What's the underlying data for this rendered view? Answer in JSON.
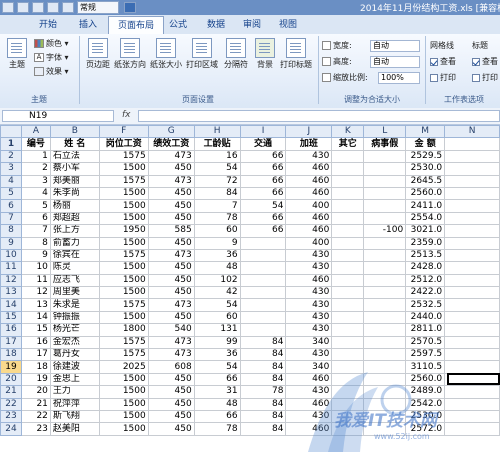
{
  "window": {
    "title": "2014年11月份结构工资.xls [兼容模式]",
    "qa_combo": "常规"
  },
  "tabs": [
    "开始",
    "插入",
    "页面布局",
    "公式",
    "数据",
    "审阅",
    "视图"
  ],
  "active_tab": "页面布局",
  "ribbon": {
    "theme_group": {
      "label": "主题",
      "theme_button": "主题",
      "colors": "颜色",
      "fonts": "字体",
      "effects": "效果"
    },
    "page_setup_group": {
      "label": "页面设置",
      "buttons": [
        "页边距",
        "纸张方向",
        "纸张大小",
        "打印区域",
        "分隔符",
        "背景",
        "打印标题"
      ]
    },
    "scale_group": {
      "label": "调整为合适大小",
      "width_label": "宽度:",
      "width_value": "自动",
      "height_label": "高度:",
      "height_value": "自动",
      "scale_label": "缩放比例:",
      "scale_value": "100%"
    },
    "sheet_options_group": {
      "label": "工作表选项",
      "gridlines": "网格线",
      "headings": "标题",
      "view": "查看",
      "print": "打印"
    }
  },
  "formula_bar": {
    "name_box": "N19",
    "fx": "fx"
  },
  "columns": [
    "A",
    "B",
    "F",
    "G",
    "H",
    "I",
    "J",
    "K",
    "L",
    "M",
    "N"
  ],
  "header_row": {
    "row": "1",
    "cells": [
      "编号",
      "姓 名",
      "岗位工资",
      "绩效工资",
      "工龄贴",
      "交通",
      "加班",
      "其它",
      "病事假",
      "金  额",
      ""
    ]
  },
  "rows": [
    {
      "row": "2",
      "cells": [
        "1",
        "石立法",
        "1575",
        "473",
        "16",
        "66",
        "430",
        "",
        "",
        "2529.5",
        ""
      ]
    },
    {
      "row": "3",
      "cells": [
        "2",
        "蔡小军",
        "1500",
        "450",
        "54",
        "66",
        "460",
        "",
        "",
        "2530.0",
        ""
      ]
    },
    {
      "row": "4",
      "cells": [
        "3",
        "郑美丽",
        "1575",
        "473",
        "72",
        "66",
        "460",
        "",
        "",
        "2645.5",
        ""
      ]
    },
    {
      "row": "5",
      "cells": [
        "4",
        "朱李尚",
        "1500",
        "450",
        "84",
        "66",
        "460",
        "",
        "",
        "2560.0",
        ""
      ]
    },
    {
      "row": "6",
      "cells": [
        "5",
        "杨丽",
        "1500",
        "450",
        "7",
        "54",
        "400",
        "",
        "",
        "2411.0",
        ""
      ]
    },
    {
      "row": "7",
      "cells": [
        "6",
        "郑超超",
        "1500",
        "450",
        "78",
        "66",
        "460",
        "",
        "",
        "2554.0",
        ""
      ]
    },
    {
      "row": "8",
      "cells": [
        "7",
        "张上方",
        "1950",
        "585",
        "60",
        "66",
        "460",
        "",
        "-100",
        "3021.0",
        ""
      ]
    },
    {
      "row": "9",
      "cells": [
        "8",
        "俞蓄力",
        "1500",
        "450",
        "9",
        "",
        "400",
        "",
        "",
        "2359.0",
        ""
      ]
    },
    {
      "row": "10",
      "cells": [
        "9",
        "徐宾在",
        "1575",
        "473",
        "36",
        "",
        "430",
        "",
        "",
        "2513.5",
        ""
      ]
    },
    {
      "row": "11",
      "cells": [
        "10",
        "陈灵",
        "1500",
        "450",
        "48",
        "",
        "430",
        "",
        "",
        "2428.0",
        ""
      ]
    },
    {
      "row": "12",
      "cells": [
        "11",
        "应志飞",
        "1500",
        "450",
        "102",
        "",
        "460",
        "",
        "",
        "2512.0",
        ""
      ]
    },
    {
      "row": "13",
      "cells": [
        "12",
        "周里美",
        "1500",
        "450",
        "42",
        "",
        "430",
        "",
        "",
        "2422.0",
        ""
      ]
    },
    {
      "row": "14",
      "cells": [
        "13",
        "朱求是",
        "1575",
        "473",
        "54",
        "",
        "430",
        "",
        "",
        "2532.5",
        ""
      ]
    },
    {
      "row": "15",
      "cells": [
        "14",
        "钟振振",
        "1500",
        "450",
        "60",
        "",
        "430",
        "",
        "",
        "2440.0",
        ""
      ]
    },
    {
      "row": "16",
      "cells": [
        "15",
        "杨光芒",
        "1800",
        "540",
        "131",
        "",
        "430",
        "",
        "",
        "2811.0",
        ""
      ]
    },
    {
      "row": "17",
      "cells": [
        "16",
        "金宏杰",
        "1575",
        "473",
        "99",
        "84",
        "340",
        "",
        "",
        "2570.5",
        ""
      ]
    },
    {
      "row": "18",
      "cells": [
        "17",
        "葛丹女",
        "1575",
        "473",
        "36",
        "84",
        "430",
        "",
        "",
        "2597.5",
        ""
      ]
    },
    {
      "row": "19",
      "cells": [
        "18",
        "徐建波",
        "2025",
        "608",
        "54",
        "84",
        "340",
        "",
        "",
        "3110.5",
        ""
      ]
    },
    {
      "row": "20",
      "cells": [
        "19",
        "金思上",
        "1500",
        "450",
        "66",
        "84",
        "460",
        "",
        "",
        "2560.0",
        ""
      ]
    },
    {
      "row": "21",
      "cells": [
        "20",
        "王力",
        "1500",
        "450",
        "31",
        "78",
        "430",
        "",
        "",
        "2489.0",
        ""
      ]
    },
    {
      "row": "22",
      "cells": [
        "21",
        "祝萍萍",
        "1500",
        "450",
        "48",
        "84",
        "460",
        "",
        "",
        "2542.0",
        ""
      ]
    },
    {
      "row": "23",
      "cells": [
        "22",
        "斯飞翔",
        "1500",
        "450",
        "66",
        "84",
        "430",
        "",
        "",
        "2530.0",
        ""
      ]
    },
    {
      "row": "24",
      "cells": [
        "23",
        "赵美阳",
        "1500",
        "450",
        "78",
        "84",
        "460",
        "",
        "",
        "2572.0",
        ""
      ]
    }
  ],
  "watermark": {
    "text": "我爱IT技术网",
    "url": "www.52ij.com"
  },
  "colors": {
    "ribbon_bg": "#dbe7f6",
    "header_bg": "#e4ecf7",
    "selected_header": "#f9d98c",
    "title_bar": "#6a8fc4"
  }
}
